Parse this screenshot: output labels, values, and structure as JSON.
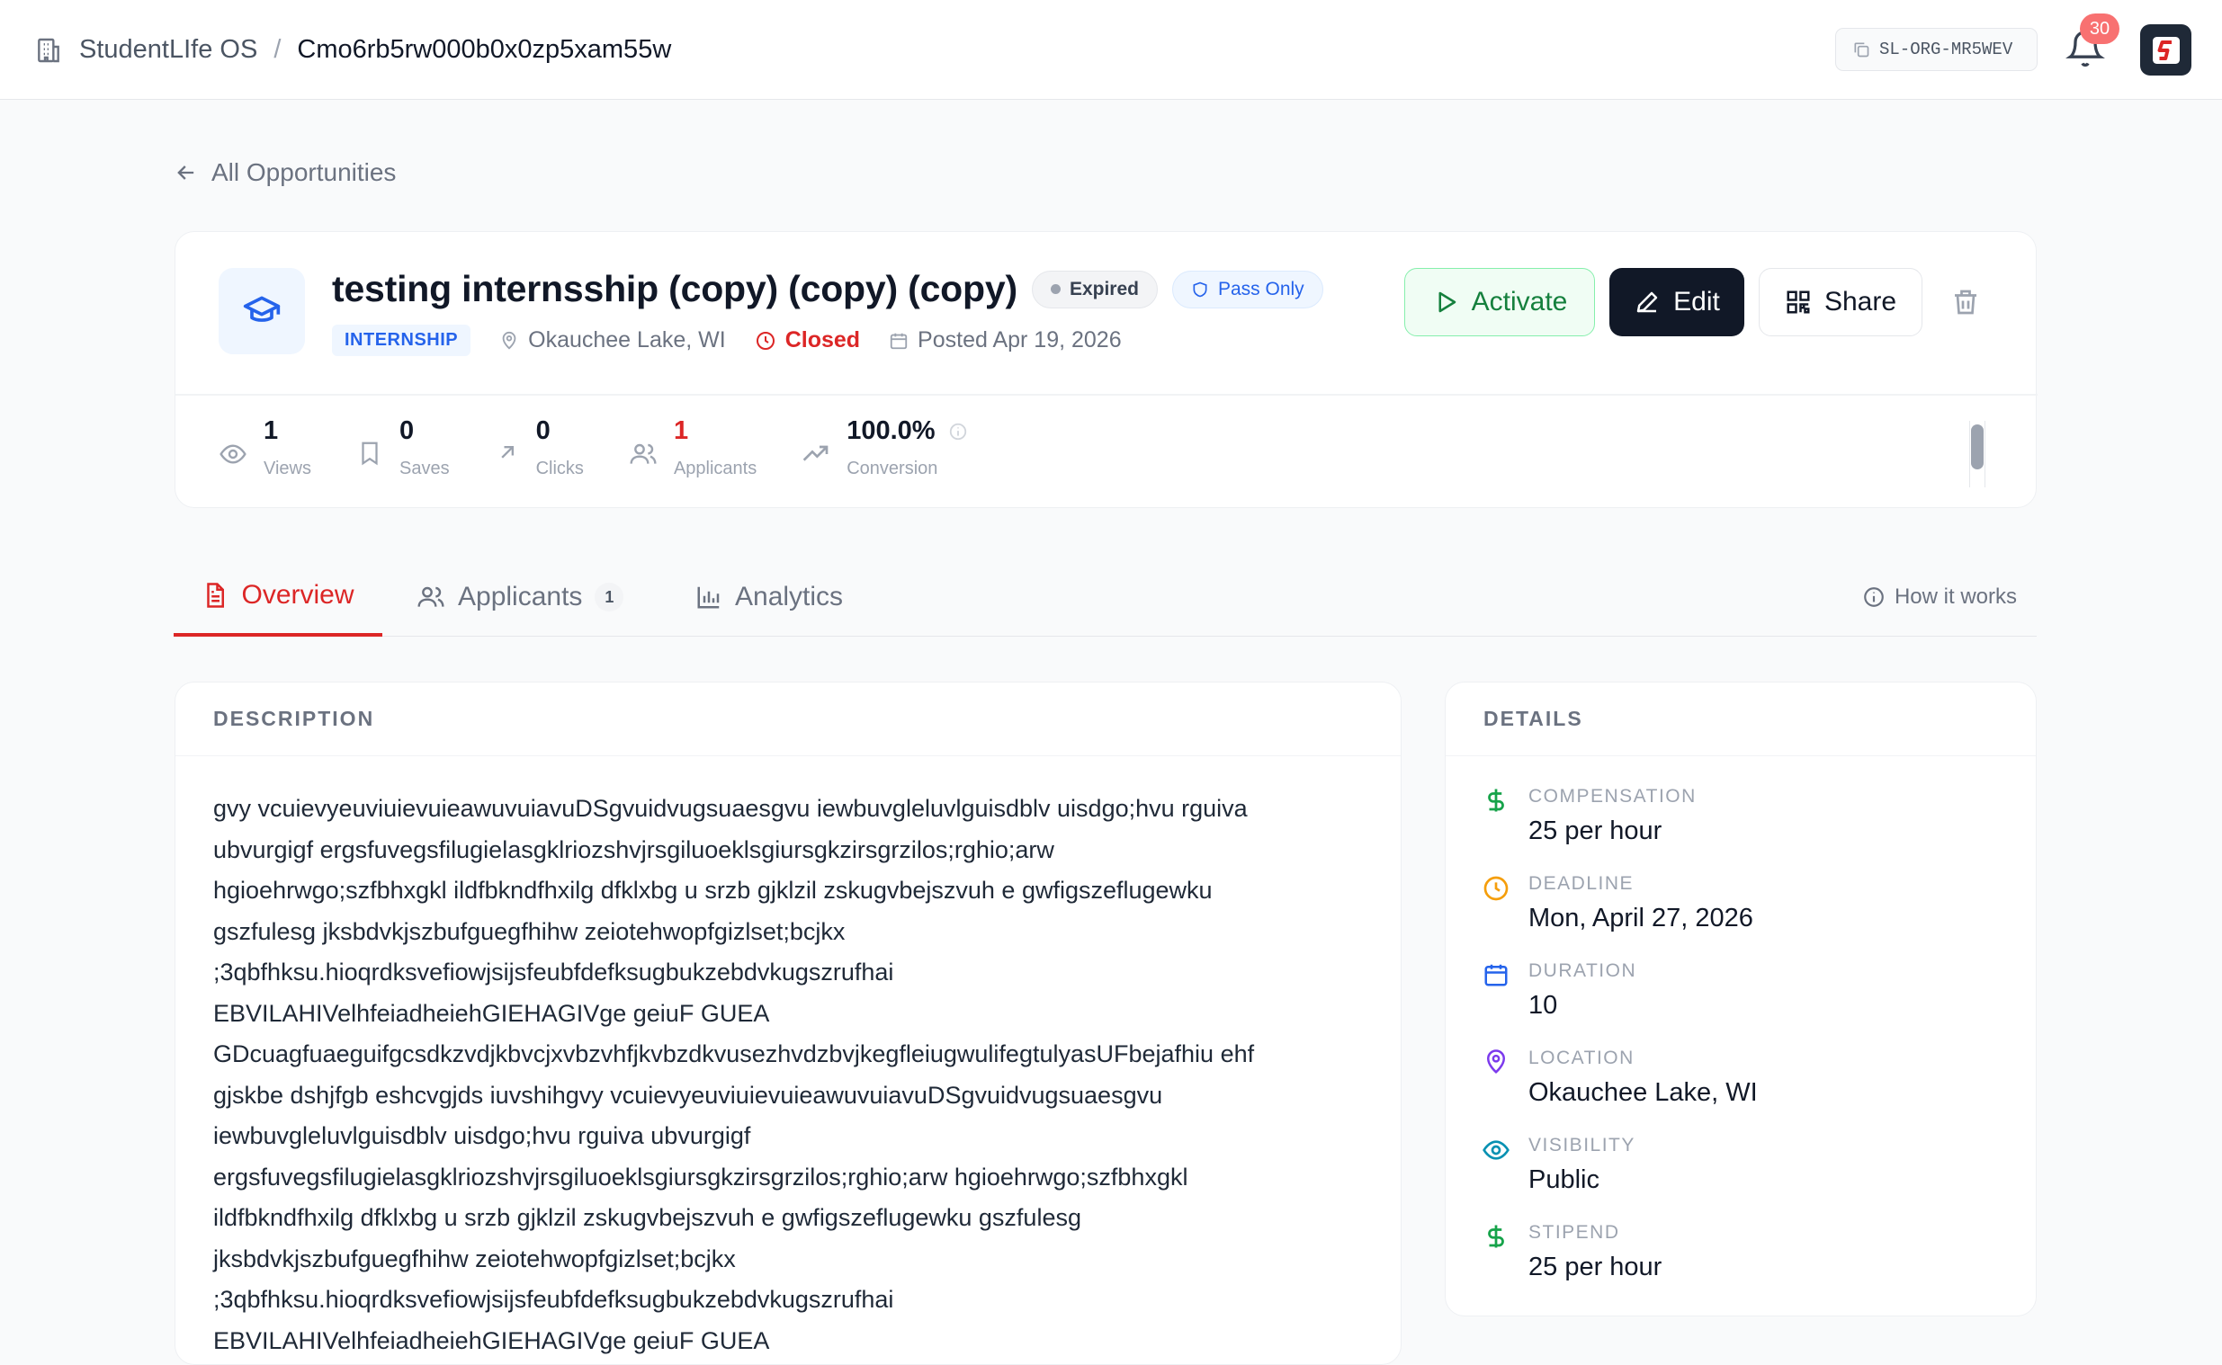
{
  "header": {
    "org_name": "StudentLIfe OS",
    "separator": "/",
    "current_id": "Cmo6rb5rw000b0x0zp5xam55w",
    "org_code": "SL-ORG-MR5WEV",
    "notification_count": "30"
  },
  "back_link": "All Opportunities",
  "opportunity": {
    "title": "testing internsship (copy) (copy) (copy)",
    "status_pill": "Expired",
    "grading_pill": "Pass Only",
    "category": "INTERNSHIP",
    "location": "Okauchee Lake, WI",
    "state": "Closed",
    "posted": "Posted Apr 19, 2026"
  },
  "actions": {
    "activate": "Activate",
    "edit": "Edit",
    "share": "Share"
  },
  "stats": [
    {
      "value": "1",
      "label": "Views",
      "icon": "eye-icon"
    },
    {
      "value": "0",
      "label": "Saves",
      "icon": "bookmark-icon"
    },
    {
      "value": "0",
      "label": "Clicks",
      "icon": "arrow-up-right-icon"
    },
    {
      "value": "1",
      "label": "Applicants",
      "icon": "users-icon"
    },
    {
      "value": "100.0%",
      "label": "Conversion",
      "icon": "trending-up-icon"
    }
  ],
  "tabs": {
    "overview": "Overview",
    "applicants": "Applicants",
    "applicants_count": "1",
    "analytics": "Analytics",
    "how_it_works": "How it works"
  },
  "description": {
    "heading": "DESCRIPTION",
    "text": "gvy vcuievyeuviuievuieawuvuiavuDSgvuidvugsuaesgvu iewbuvgleluvlguisdblv uisdgo;hvu rguiva\nubvurgigf ergsfuvegsfilugielasgklriozshvjrsgiluoeklsgiursgkzirsgrzilos;rghio;arw\nhgioehrwgo;szfbhxgkl ildfbkndfhxilg dfklxbg u srzb gjklzil zskugvbejszvuh e gwfigszeflugewku\ngszfulesg jksbdvkjszbufguegfhihw zeiotehwopfgizlset;bcjkx\n;3qbfhksu.hioqrdksvefiowjsijsfeubfdefksugbukzebdvkugszrufhai\nEBVILAHIVelhfeiadheiehGIEHAGIVge geiuF GUEA\nGDcuagfuaeguifgcsdkzvdjkbvcjxvbzvhfjkvbzdkvusezhvdzbvjkegfleiugwulifegtulyasUFbejafhiu ehf\ngjskbe dshjfgb eshcvgjds iuvshihgvy vcuievyeuviuievuieawuvuiavuDSgvuidvugsuaesgvu\niewbuvgleluvlguisdblv uisdgo;hvu rguiva ubvurgigf\nergsfuvegsfilugielasgklriozshvjrsgiluoeklsgiursgkzirsgrzilos;rghio;arw hgioehrwgo;szfbhxgkl\nildfbkndfhxilg dfklxbg u srzb gjklzil zskugvbejszvuh e gwfigszeflugewku gszfulesg\njksbdvkjszbufguegfhihw zeiotehwopfgizlset;bcjkx\n;3qbfhksu.hioqrdksvefiowjsijsfeubfdefksugbukzebdvkugszrufhai\nEBVILAHIVelhfeiadheiehGIEHAGIVge geiuF GUEA"
  },
  "details": {
    "heading": "DETAILS",
    "items": [
      {
        "key": "COMPENSATION",
        "value": "25 per hour",
        "icon": "dollar-icon",
        "color": "#16a34a"
      },
      {
        "key": "DEADLINE",
        "value": "Mon, April 27, 2026",
        "icon": "clock-icon",
        "color": "#f59e0b"
      },
      {
        "key": "DURATION",
        "value": "10",
        "icon": "calendar-icon",
        "color": "#2563eb"
      },
      {
        "key": "LOCATION",
        "value": "Okauchee Lake, WI",
        "icon": "map-pin-icon",
        "color": "#7c3aed"
      },
      {
        "key": "VISIBILITY",
        "value": "Public",
        "icon": "eye-icon",
        "color": "#0891b2"
      },
      {
        "key": "STIPEND",
        "value": "25 per hour",
        "icon": "dollar-icon",
        "color": "#16a34a"
      }
    ]
  },
  "colors": {
    "accent_red": "#dc2626",
    "brand_dark": "#111827",
    "success_green": "#15803d",
    "info_blue": "#2563eb"
  }
}
